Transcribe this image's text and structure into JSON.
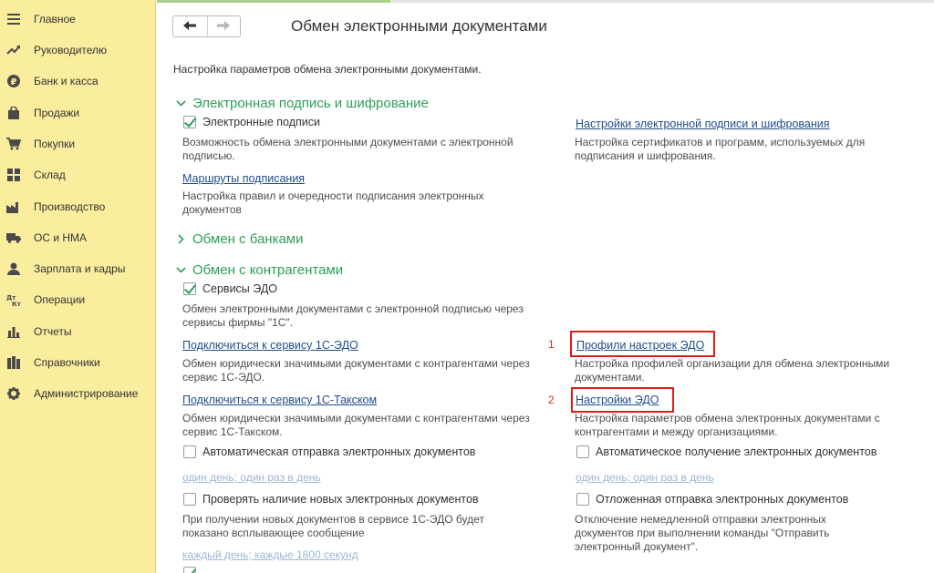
{
  "sidebar": {
    "items": [
      {
        "label": "Главное",
        "icon": "menu-icon"
      },
      {
        "label": "Руководителю",
        "icon": "trend-icon"
      },
      {
        "label": "Банк и касса",
        "icon": "coin-icon"
      },
      {
        "label": "Продажи",
        "icon": "bag-icon"
      },
      {
        "label": "Покупки",
        "icon": "cart-icon"
      },
      {
        "label": "Склад",
        "icon": "grid-icon"
      },
      {
        "label": "Производство",
        "icon": "factory-icon"
      },
      {
        "label": "ОС и НМА",
        "icon": "truck-icon"
      },
      {
        "label": "Зарплата и кадры",
        "icon": "person-icon"
      },
      {
        "label": "Операции",
        "icon": "dt-kt-icon"
      },
      {
        "label": "Отчеты",
        "icon": "bar-chart-icon"
      },
      {
        "label": "Справочники",
        "icon": "books-icon"
      },
      {
        "label": "Администрирование",
        "icon": "gear-icon"
      }
    ]
  },
  "page": {
    "title": "Обмен электронными документами",
    "description": "Настройка параметров обмена электронными документами."
  },
  "sections": {
    "signature": {
      "title": "Электронная подпись и шифрование",
      "signatures_checkbox": "Электронные подписи",
      "signatures_desc": "Возможность обмена электронными документами с электронной подписью.",
      "settings_link": "Настройки электронной подписи и шифрования",
      "settings_desc": "Настройка сертификатов и программ, используемых для подписания и шифрования.",
      "routes_link": "Маршруты подписания",
      "routes_desc": "Настройка правил и очередности подписания электронных документов"
    },
    "banks": {
      "title": "Обмен с банками"
    },
    "contractors": {
      "title": "Обмен с контрагентами",
      "edo_checkbox": "Сервисы ЭДО",
      "edo_desc": "Обмен электронными документами с электронной подписью через сервисы фирмы \"1С\".",
      "connect_edo_link": "Подключиться к сервису 1С-ЭДО",
      "connect_edo_desc": "Обмен юридически значимыми документами с контрагентами через сервис 1С-ЭДО.",
      "connect_taxcom_link": "Подключиться к сервису 1С-Такском",
      "connect_taxcom_desc": "Обмен юридически значимыми документами с контрагентами через сервис 1С-Такском.",
      "profiles_marker": "1",
      "profiles_link": "Профили настроек ЭДО",
      "profiles_desc": "Настройка профилей организации для обмена электронными документами.",
      "edo_settings_marker": "2",
      "edo_settings_link": "Настройки ЭДО",
      "edo_settings_desc": "Настройка параметров обмена электронных документами с контрагентами и между организациями.",
      "auto_send_checkbox": "Автоматическая отправка электронных документов",
      "auto_send_schedule": "один день; один раз в день",
      "auto_receive_checkbox": "Автоматическое получение электронных документов",
      "auto_receive_schedule": "один день; один раз в день",
      "check_new_checkbox": "Проверять наличие новых электронных документов",
      "check_new_desc": "При получении новых документов в сервисе 1С-ЭДО будет показано всплывающее сообщение",
      "check_new_schedule": "каждый день; каждые 1800 секунд",
      "deferred_send_checkbox": "Отложенная отправка электронных документов",
      "deferred_send_desc": "Отключение немедленной отправки электронных документов при выполнении команды \"Отправить электронный документ\"."
    }
  },
  "colors": {
    "sidebar_bg": "#fbed9e",
    "section_green": "#2f9e55",
    "link_blue": "#1f4d8c",
    "highlight_red": "#e01b1b"
  }
}
